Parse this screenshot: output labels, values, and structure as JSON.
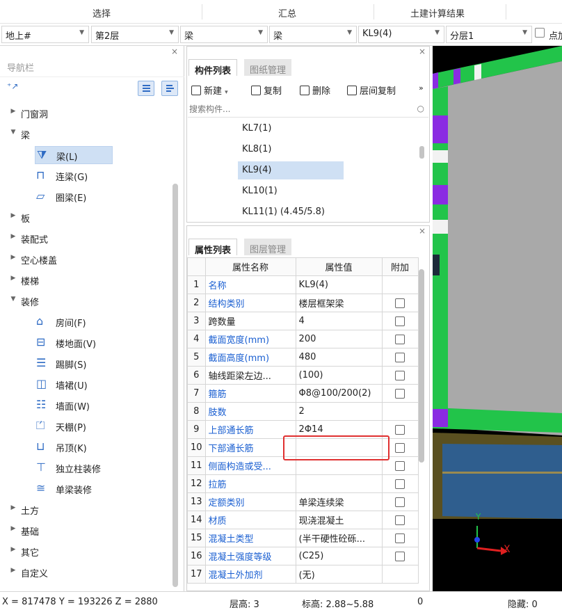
{
  "ribbon": {
    "tabs": [
      "选择",
      "汇总",
      "土建计算结果"
    ]
  },
  "selectors": {
    "floor_group": "地上#",
    "floor": "第2层",
    "category1": "梁",
    "category2": "梁",
    "component": "KL9(4)",
    "sublayer": "分层1",
    "checkbox_label": "点加"
  },
  "nav": {
    "title": "导航栏",
    "close": "×",
    "items": [
      {
        "label": "门窗洞",
        "expanded": false
      },
      {
        "label": "梁",
        "expanded": true
      },
      {
        "label": "梁(L)",
        "child": true,
        "icon": "beam-icon",
        "selected": true
      },
      {
        "label": "连梁(G)",
        "child": true,
        "icon": "coupling-beam-icon"
      },
      {
        "label": "圈梁(E)",
        "child": true,
        "icon": "ring-beam-icon"
      },
      {
        "label": "板",
        "expanded": false
      },
      {
        "label": "装配式",
        "expanded": false
      },
      {
        "label": "空心楼盖",
        "expanded": false
      },
      {
        "label": "楼梯",
        "expanded": false
      },
      {
        "label": "装修",
        "expanded": true
      },
      {
        "label": "房间(F)",
        "child": true,
        "icon": "room-icon"
      },
      {
        "label": "楼地面(V)",
        "child": true,
        "icon": "floor-icon"
      },
      {
        "label": "踢脚(S)",
        "child": true,
        "icon": "skirting-icon"
      },
      {
        "label": "墙裙(U)",
        "child": true,
        "icon": "dado-icon"
      },
      {
        "label": "墙面(W)",
        "child": true,
        "icon": "wall-surface-icon"
      },
      {
        "label": "天棚(P)",
        "child": true,
        "icon": "ceiling-icon"
      },
      {
        "label": "吊顶(K)",
        "child": true,
        "icon": "suspended-ceiling-icon"
      },
      {
        "label": "独立柱装修",
        "child": true,
        "icon": "column-finish-icon"
      },
      {
        "label": "单梁装修",
        "child": true,
        "icon": "beam-finish-icon"
      },
      {
        "label": "土方",
        "expanded": false
      },
      {
        "label": "基础",
        "expanded": false
      },
      {
        "label": "其它",
        "expanded": false
      },
      {
        "label": "自定义",
        "expanded": false
      }
    ]
  },
  "component_panel": {
    "tabs": [
      "构件列表",
      "图纸管理"
    ],
    "close": "×",
    "toolbar": {
      "new": "新建",
      "copy": "复制",
      "delete": "删除",
      "floor_copy": "层间复制",
      "more": "»"
    },
    "search_placeholder": "搜索构件...",
    "items": [
      "KL7(1)",
      "KL8(1)",
      "KL9(4)",
      "KL10(1)",
      "KL11(1)  (4.45/5.8)"
    ],
    "selected": "KL9(4)"
  },
  "property_panel": {
    "tabs": [
      "属性列表",
      "图层管理"
    ],
    "close": "×",
    "headers": [
      "属性名称",
      "属性值",
      "附加"
    ],
    "rows": [
      {
        "n": "1",
        "name": "名称",
        "value": "KL9(4)",
        "check": false
      },
      {
        "n": "2",
        "name": "结构类别",
        "value": "楼层框架梁",
        "check": true
      },
      {
        "n": "3",
        "name": "跨数量",
        "value": "4",
        "check": true,
        "black": true
      },
      {
        "n": "4",
        "name": "截面宽度(mm)",
        "value": "200",
        "check": true
      },
      {
        "n": "5",
        "name": "截面高度(mm)",
        "value": "480",
        "check": true
      },
      {
        "n": "6",
        "name": "轴线距梁左边...",
        "value": "(100)",
        "check": true,
        "black": true
      },
      {
        "n": "7",
        "name": "箍筋",
        "value": "Φ8@100/200(2)",
        "check": true
      },
      {
        "n": "8",
        "name": "肢数",
        "value": "2",
        "check": false
      },
      {
        "n": "9",
        "name": "上部通长筋",
        "value": "2Φ14",
        "check": true
      },
      {
        "n": "10",
        "name": "下部通长筋",
        "value": "",
        "check": true
      },
      {
        "n": "11",
        "name": "侧面构造或受...",
        "value": "",
        "check": true
      },
      {
        "n": "12",
        "name": "拉筋",
        "value": "",
        "check": true
      },
      {
        "n": "13",
        "name": "定额类别",
        "value": "单梁连续梁",
        "check": true
      },
      {
        "n": "14",
        "name": "材质",
        "value": "现浇混凝土",
        "check": true
      },
      {
        "n": "15",
        "name": "混凝土类型",
        "value": "(半干硬性砼砾...",
        "check": true
      },
      {
        "n": "16",
        "name": "混凝土强度等级",
        "value": "(C25)",
        "check": true
      },
      {
        "n": "17",
        "name": "混凝土外加剂",
        "value": "(无)",
        "check": false
      }
    ]
  },
  "viewport": {
    "axis_y": "Y",
    "axis_x": "X"
  },
  "status": {
    "coords": "X = 817478 Y = 193226 Z = 2880",
    "floor_height": "层高:  3",
    "elevation": "标高:  2.88~5.88",
    "count": "0",
    "hidden": "隐藏:  0"
  },
  "colors": {
    "accent": "#1a5fd1",
    "selection": "#cfe0f4",
    "highlight": "#e03030"
  }
}
